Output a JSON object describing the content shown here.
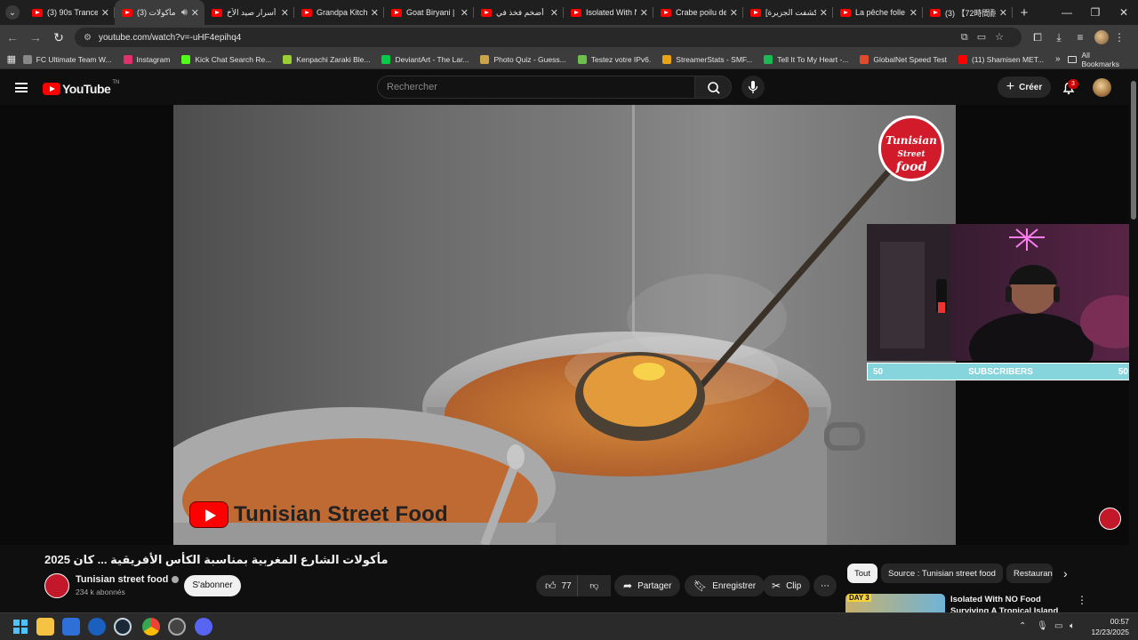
{
  "browser": {
    "tabs": [
      {
        "title": "(3) 90s Trance",
        "active": false
      },
      {
        "title": "(3) مأكولات",
        "active": true
      },
      {
        "title": "أسرار صيد الأخ",
        "active": false
      },
      {
        "title": "Grandpa Kitche",
        "active": false
      },
      {
        "title": "Goat Biryani |",
        "active": false
      },
      {
        "title": "أضخم فخذ في",
        "active": false
      },
      {
        "title": "Isolated With N",
        "active": false
      },
      {
        "title": "Crabe poilu de",
        "active": false
      },
      {
        "title": "[كشفت الجزيرة]",
        "active": false
      },
      {
        "title": "La pêche folle",
        "active": false
      },
      {
        "title": "(3) 【72時間耐",
        "active": false
      }
    ],
    "url": "youtube.com/watch?v=-uHF4epihq4",
    "bookmarks": [
      {
        "label": "FC Ultimate Team W...",
        "color": "#888888"
      },
      {
        "label": "Instagram",
        "color": "#e1306c"
      },
      {
        "label": "Kick Chat Search Re...",
        "color": "#53fc18"
      },
      {
        "label": "Kenpachi Zaraki Ble...",
        "color": "#9acd32"
      },
      {
        "label": "DeviantArt - The Lar...",
        "color": "#05cc47"
      },
      {
        "label": "Photo Quiz - Guess...",
        "color": "#caa34a"
      },
      {
        "label": "Testez votre IPv6.",
        "color": "#6cbf4a"
      },
      {
        "label": "StreamerStats - SMF...",
        "color": "#e8a317"
      },
      {
        "label": "Tell It To My Heart -...",
        "color": "#1db954"
      },
      {
        "label": "GlobalNet Speed Test",
        "color": "#e04b2d"
      },
      {
        "label": "(11) Shamisen MET...",
        "color": "#ff0000"
      }
    ],
    "all_bookmarks": "All Bookmarks"
  },
  "youtube": {
    "logo_text": "YouTube",
    "logo_tm": "TN",
    "search_placeholder": "Rechercher",
    "create_label": "Créer",
    "notification_count": "3",
    "video": {
      "watermark_text": "Tunisian Street Food",
      "watermark_logo_line1": "Tunisian",
      "watermark_logo_line2": "Street",
      "watermark_logo_line3": "food",
      "subscribers_left": "50",
      "subscribers_label": "SUBSCRIBERS",
      "subscribers_right": "50"
    },
    "title": "مأكولات الشارع المغربية بمناسبة الكأس الأفريقية ... كان 2025",
    "channel": {
      "name": "Tunisian street food",
      "subscribers": "234 k abonnés",
      "subscribe_label": "S'abonner"
    },
    "actions": {
      "like_count": "77",
      "share_label": "Partager",
      "save_label": "Enregistrer",
      "clip_label": "Clip"
    },
    "chips": [
      "Tout",
      "Source : Tunisian street food",
      "Restauran"
    ],
    "recommendation": {
      "title": "Isolated With NO Food Surviving A Tropical Island",
      "badge": "DAY 3"
    }
  },
  "taskbar": {
    "time": "00:57",
    "date": "12/23/2025"
  }
}
